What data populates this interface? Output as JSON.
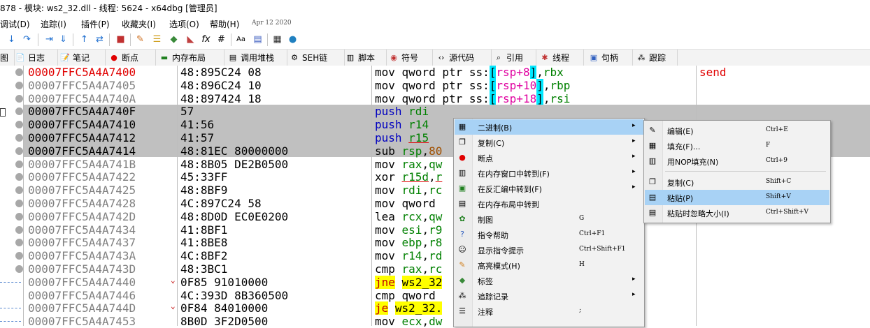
{
  "window": {
    "title": "878 - 模块: ws2_32.dll - 线程: 5624 - x64dbg [管理员]"
  },
  "menu": {
    "items": [
      "调试(D)",
      "追踪(I)",
      "插件(P)",
      "收藏夹(I)",
      "选项(O)",
      "帮助(H)"
    ],
    "date": "Apr 12 2020"
  },
  "toolbar": {
    "icons": [
      "step-into-icon",
      "step-over-icon",
      "step-back-icon",
      "run-to-icon",
      "step-up-icon",
      "animate-icon",
      "trace-icon",
      "break-icon",
      "patch-icon",
      "comment-icon",
      "label-icon",
      "bookmark-icon",
      "function-icon",
      "hash-icon",
      "font-icon",
      "script-icon",
      "calculator-icon",
      "globe-icon"
    ]
  },
  "tabs": [
    "图",
    "日志",
    "笔记",
    "断点",
    "内存布局",
    "调用堆栈",
    "SEH链",
    "脚本",
    "符号",
    "源代码",
    "引用",
    "线程",
    "句柄",
    "跟踪"
  ],
  "disasm": {
    "rows": [
      {
        "addr": "00007FFC5A4A7400",
        "bytes": "48:895C24 08",
        "comment": "send"
      },
      {
        "addr": "00007FFC5A4A7405",
        "bytes": "48:896C24 10"
      },
      {
        "addr": "00007FFC5A4A740A",
        "bytes": "48:897424 18"
      },
      {
        "addr": "00007FFC5A4A740F",
        "bytes": "57"
      },
      {
        "addr": "00007FFC5A4A7410",
        "bytes": "41:56"
      },
      {
        "addr": "00007FFC5A4A7412",
        "bytes": "41:57"
      },
      {
        "addr": "00007FFC5A4A7414",
        "bytes": "48:81EC 80000000"
      },
      {
        "addr": "00007FFC5A4A741B",
        "bytes": "48:8B05 DE2B0500"
      },
      {
        "addr": "00007FFC5A4A7422",
        "bytes": "45:33FF"
      },
      {
        "addr": "00007FFC5A4A7425",
        "bytes": "48:8BF9"
      },
      {
        "addr": "00007FFC5A4A7428",
        "bytes": "4C:897C24 58"
      },
      {
        "addr": "00007FFC5A4A742D",
        "bytes": "48:8D0D EC0E0200"
      },
      {
        "addr": "00007FFC5A4A7434",
        "bytes": "41:8BF1"
      },
      {
        "addr": "00007FFC5A4A7437",
        "bytes": "41:8BE8"
      },
      {
        "addr": "00007FFC5A4A743A",
        "bytes": "4C:8BF2"
      },
      {
        "addr": "00007FFC5A4A743D",
        "bytes": "48:3BC1"
      },
      {
        "addr": "00007FFC5A4A7440",
        "bytes": "0F85 91010000"
      },
      {
        "addr": "00007FFC5A4A7446",
        "bytes": "4C:393D 8B360500"
      },
      {
        "addr": "00007FFC5A4A744D",
        "bytes": "0F84 84010000"
      },
      {
        "addr": "00007FFC5A4A7453",
        "bytes": "8B0D 3F2D0500"
      }
    ],
    "instr": {
      "r0": {
        "op": "mov qword ptr ss:",
        "l": "[",
        "m": "rsp+8",
        "r": "]",
        ",": ",",
        "reg": "rbx"
      },
      "r1": {
        "op": "mov qword ptr ss:",
        "l": "[",
        "m": "rsp+10",
        "r": "]",
        ",": ",",
        "reg": "rbp"
      },
      "r2": {
        "op": "mov qword ptr ss:",
        "l": "[",
        "m": "rsp+18",
        "r": "]",
        ",": ",",
        "reg": "rsi"
      },
      "r3": {
        "op": "push ",
        "reg": "rdi"
      },
      "r4": {
        "op": "push ",
        "reg": "r14"
      },
      "r5": {
        "op": "push ",
        "reg": "r15"
      },
      "r6": {
        "op": "sub ",
        "reg": "rsp",
        ",": ",",
        "num": "80"
      },
      "r7": {
        "op": "mov ",
        "reg": "rax",
        ",": ",",
        "tail": "qw"
      },
      "r8": {
        "op": "xor ",
        "reg": "r15d",
        ",": ",",
        "reg2": "r"
      },
      "r9": {
        "op": "mov ",
        "reg": "rdi",
        ",": ",",
        "tail": "rc"
      },
      "r10": {
        "op": "mov qword"
      },
      "r11": {
        "op": "lea ",
        "reg": "rcx",
        ",": ",",
        "tail": "qw"
      },
      "r12": {
        "op": "mov ",
        "reg": "esi",
        ",": ",",
        "tail": "r9"
      },
      "r13": {
        "op": "mov ",
        "reg": "ebp",
        ",": ",",
        "tail": "r8"
      },
      "r14": {
        "op": "mov ",
        "reg": "r14",
        ",": ",",
        "tail": "rd"
      },
      "r15": {
        "op": "cmp ",
        "reg": "rax",
        ",": ",",
        "tail": "rc"
      },
      "r16": {
        "jmp": "jne",
        "sp": " ",
        "tgt": "ws2_32"
      },
      "r17": {
        "op": "cmp qword"
      },
      "r18": {
        "jmp": "je",
        "sp": " ",
        "tgt": "ws2_32."
      },
      "r19": {
        "op": "mov ",
        "reg": "ecx",
        ",": ",",
        "tail": "dw"
      }
    }
  },
  "context_menu": {
    "items": [
      {
        "label": "二进制(B)",
        "shortcut": "",
        "arrow": "▸",
        "icon": "binary-icon"
      },
      {
        "label": "复制(C)",
        "shortcut": "",
        "arrow": "▸",
        "icon": "copy-icon"
      },
      {
        "label": "断点",
        "shortcut": "",
        "arrow": "▸",
        "icon": "breakpoint-icon"
      },
      {
        "label": "在内存窗口中转到(F)",
        "shortcut": "",
        "arrow": "▸",
        "icon": "memory-icon"
      },
      {
        "label": "在反汇编中转到(F)",
        "shortcut": "",
        "arrow": "▸",
        "icon": "cpu-icon"
      },
      {
        "label": "在内存布局中转到",
        "shortcut": "",
        "arrow": "",
        "icon": "memmap-icon"
      },
      {
        "label": "制图",
        "shortcut": "G",
        "arrow": "",
        "icon": "graph-icon"
      },
      {
        "label": "指令帮助",
        "shortcut": "Ctrl+F1",
        "arrow": "",
        "icon": "help-icon"
      },
      {
        "label": "显示指令提示",
        "shortcut": "Ctrl+Shift+F1",
        "arrow": "",
        "icon": "hint-icon"
      },
      {
        "label": "高亮模式(H)",
        "shortcut": "H",
        "arrow": "",
        "icon": "highlight-icon"
      },
      {
        "label": "标签",
        "shortcut": "",
        "arrow": "▸",
        "icon": "label-icon"
      },
      {
        "label": "追踪记录",
        "shortcut": "",
        "arrow": "▸",
        "icon": "trace-record-icon"
      },
      {
        "label": "注释",
        "shortcut": ";",
        "arrow": "",
        "icon": "comment-icon"
      }
    ]
  },
  "submenu": {
    "items": [
      {
        "label": "编辑(E)",
        "shortcut": "Ctrl+E",
        "icon": "edit-icon"
      },
      {
        "label": "填充(F)...",
        "shortcut": "F",
        "icon": "fill-icon"
      },
      {
        "label": "用NOP填充(N)",
        "shortcut": "Ctrl+9",
        "icon": "nop-icon"
      },
      {
        "label": "复制(C)",
        "shortcut": "Shift+C",
        "icon": "copy-icon"
      },
      {
        "label": "粘贴(P)",
        "shortcut": "Shift+V",
        "icon": "paste-icon"
      },
      {
        "label": "粘贴时忽略大小(I)",
        "shortcut": "Ctrl+Shift+V",
        "icon": "paste-ignore-icon"
      }
    ]
  }
}
